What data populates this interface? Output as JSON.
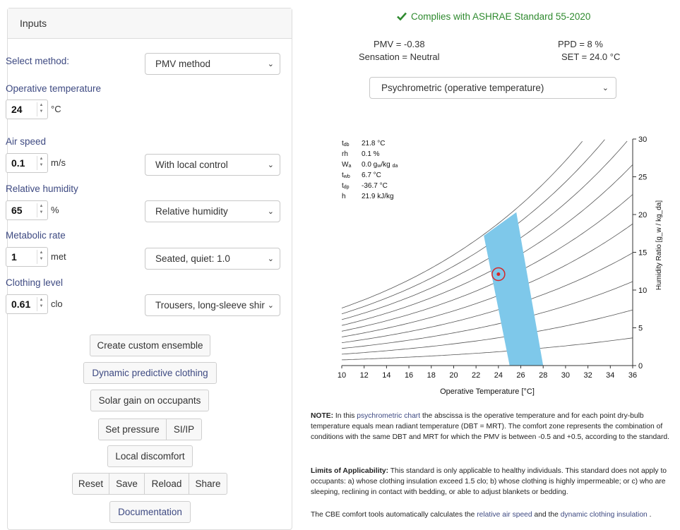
{
  "inputs": {
    "header": "Inputs",
    "select_method_label": "Select method:",
    "method_value": "PMV method",
    "operative_temp_label": "Operative temperature",
    "operative_temp_value": "24",
    "operative_temp_unit": "°C",
    "air_speed_label": "Air speed",
    "air_speed_value": "0.1",
    "air_speed_unit": "m/s",
    "air_speed_control": "With local control",
    "rh_label": "Relative humidity",
    "rh_value": "65",
    "rh_unit": "%",
    "rh_mode": "Relative humidity",
    "met_label": "Metabolic rate",
    "met_value": "1",
    "met_unit": "met",
    "met_activity": "Seated, quiet: 1.0",
    "clo_label": "Clothing level",
    "clo_value": "0.61",
    "clo_unit": "clo",
    "clo_ensemble": "Trousers, long-sleeve shirt"
  },
  "buttons": {
    "custom_ensemble": "Create custom ensemble",
    "dynamic_clothing": "Dynamic predictive clothing",
    "solar_gain": "Solar gain on occupants",
    "set_pressure": "Set pressure",
    "si_ip": "SI/IP",
    "local_discomfort": "Local discomfort",
    "reset": "Reset",
    "save": "Save",
    "reload": "Reload",
    "share": "Share",
    "documentation": "Documentation"
  },
  "results": {
    "compliance": "Complies with ASHRAE Standard 55-2020",
    "pmv": "PMV = -0.38",
    "ppd": "PPD = 8 %",
    "sensation": "Sensation = Neutral",
    "set": "SET = 24.0 °C",
    "chart_select": "Psychrometric (operative temperature)"
  },
  "readout": {
    "tdb_label": "t",
    "tdb_sub": "db",
    "tdb_value": "21.8  °C",
    "rh_label": "rh",
    "rh_value": "0.1   %",
    "wa_label": "W",
    "wa_sub": "a",
    "wa_value": "0.0   g",
    "wa_unit_sub1": "w",
    "wa_unit": "/kg",
    "wa_unit_sub2": "da",
    "twb_label": "t",
    "twb_sub": "wb",
    "twb_value": "6.7   °C",
    "tdp_label": "t",
    "tdp_sub": "dp",
    "tdp_value": "-36.7 °C",
    "h_label": "h",
    "h_value": "21.9  kJ/kg"
  },
  "colors": {
    "accent": "#3e4a82",
    "comfort_zone": "#7ec8ea",
    "point": "#d62728",
    "success": "#2f8a2f"
  },
  "chart_data": {
    "type": "line",
    "xlabel": "Operative Temperature [°C]",
    "ylabel": "Humidity Ratio [g_w / kg_da]",
    "xlim": [
      10,
      36
    ],
    "ylim": [
      0,
      30
    ],
    "x_ticks": [
      "10",
      "12",
      "14",
      "16",
      "18",
      "20",
      "22",
      "24",
      "26",
      "28",
      "30",
      "32",
      "34",
      "36"
    ],
    "y_ticks": [
      "0",
      "5",
      "10",
      "15",
      "20",
      "25",
      "30"
    ],
    "rh_curves_percent": [
      10,
      20,
      30,
      40,
      50,
      60,
      70,
      80,
      90,
      100
    ],
    "comfort_zone": [
      [
        22.7,
        17.2
      ],
      [
        25.6,
        20.3
      ],
      [
        28.0,
        0
      ],
      [
        25.0,
        0
      ]
    ],
    "current_point": {
      "x": 24.0,
      "y": 12.1
    }
  },
  "notes": {
    "note_title": "NOTE:",
    "note_pre": " In this ",
    "note_link": "psychrometric chart",
    "note_post": " the abscissa is the operative temperature and for each point dry-bulb temperature equals mean radiant temperature (DBT = MRT). The comfort zone represents the combination of conditions with the same DBT and MRT for which the PMV is between -0.5 and +0.5, according to the standard.",
    "limits_title": "Limits of Applicability:",
    "limits_text": " This standard is only applicable to healthy individuals. This standard does not apply to occupants: a) whose clothing insulation exceed 1.5 clo; b) whose clothing is highly impermeable; or c) who are sleeping, reclining in contact with bedding, or able to adjust blankets or bedding.",
    "cbe_pre": "The CBE comfort tools automatically calculates the ",
    "cbe_link1": "relative air speed",
    "cbe_mid": " and the ",
    "cbe_link2": "dynamic clothing insulation",
    "cbe_post": " ."
  }
}
